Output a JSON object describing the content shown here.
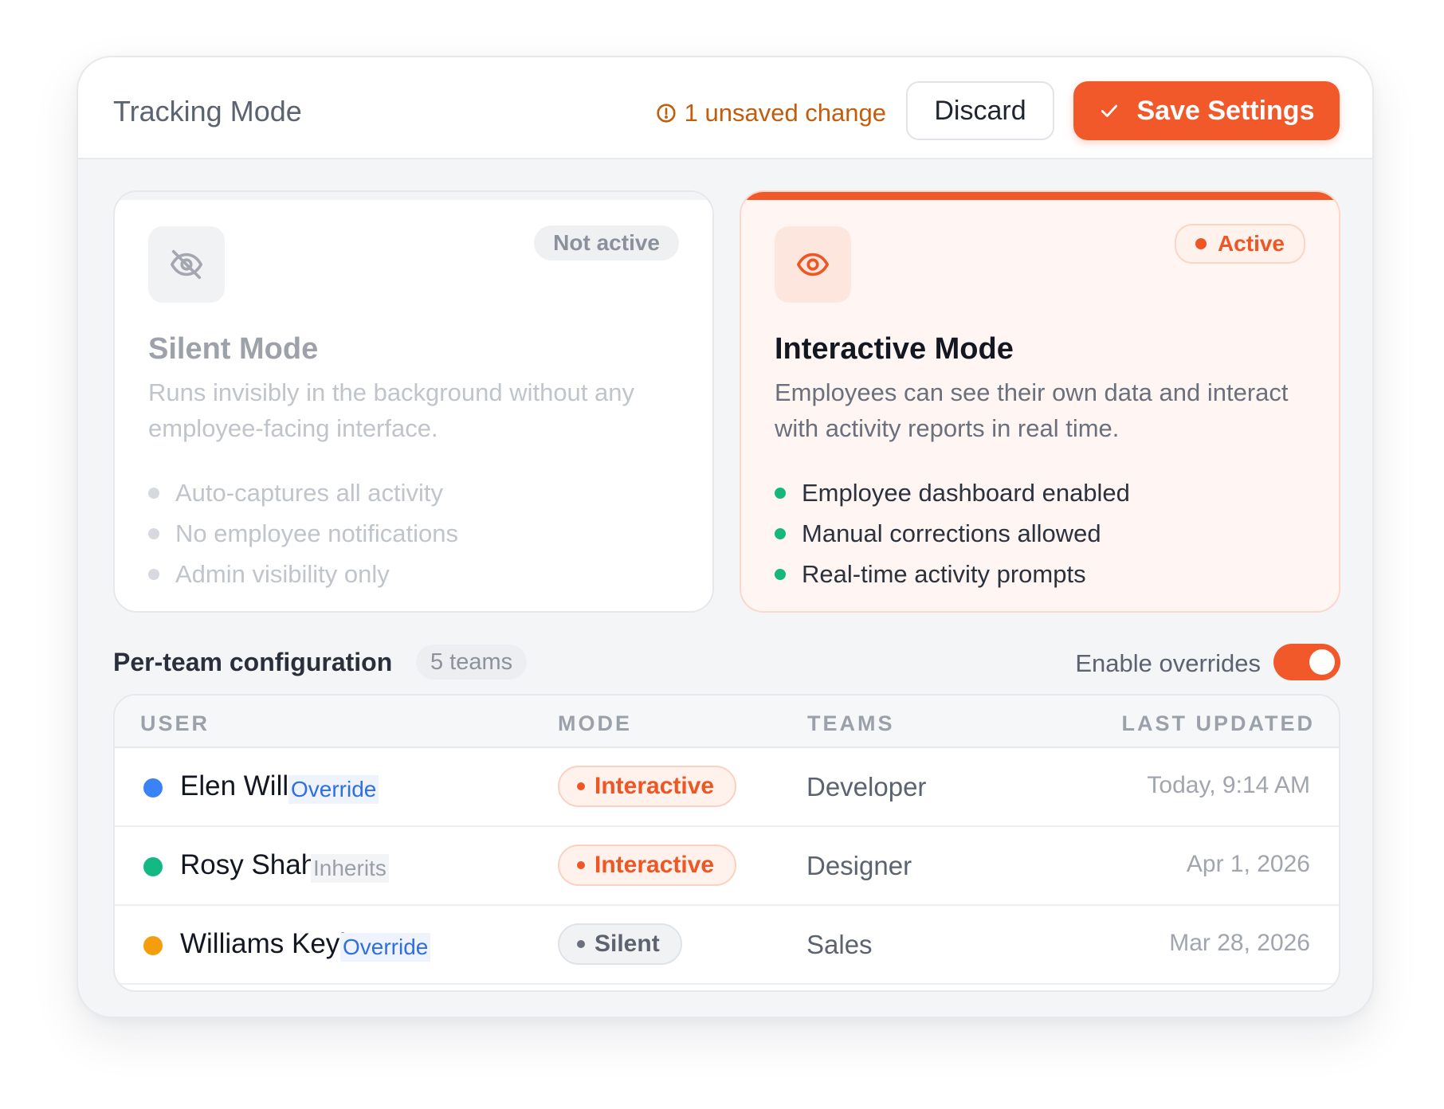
{
  "header": {
    "title": "Tracking Mode",
    "unsaved_text": "1 unsaved change",
    "discard_label": "Discard",
    "save_label": "Save Settings"
  },
  "modes": {
    "silent": {
      "title": "Silent Mode",
      "status": "Not active",
      "description": "Runs invisibly in the background without any employee-facing interface.",
      "features": [
        "Auto-captures all activity",
        "No employee notifications",
        "Admin visibility only"
      ],
      "icon": "eye-off-icon"
    },
    "interactive": {
      "title": "Interactive Mode",
      "status": "Active",
      "description": "Employees can see their own data and interact with activity reports in real time.",
      "features": [
        "Employee dashboard enabled",
        "Manual corrections allowed",
        "Real-time activity prompts"
      ],
      "icon": "eye-icon"
    }
  },
  "team_config": {
    "title": "Per-team configuration",
    "count_label": "5 teams",
    "overrides_label": "Enable overrides",
    "overrides_enabled": true
  },
  "table": {
    "columns": [
      "USER",
      "MODE",
      "TEAMS",
      "LAST UPDATED"
    ],
    "rows": [
      {
        "name": "Elen Will",
        "tag": "Override",
        "mode": "Interactive",
        "team": "Developer",
        "updated": "Today, 9:14 AM",
        "dot_color": "#3b82f6"
      },
      {
        "name": "Rosy Shah",
        "tag": "Inherits",
        "mode": "Interactive",
        "team": "Designer",
        "updated": "Apr 1, 2026",
        "dot_color": "#14b882"
      },
      {
        "name": "Williams Keyl",
        "tag": "Override",
        "mode": "Silent",
        "team": "Sales",
        "updated": "Mar 28, 2026",
        "dot_color": "#f59e0b"
      }
    ]
  },
  "colors": {
    "accent": "#f2592a",
    "warning_text": "#c25d0e",
    "success": "#16b77b",
    "override_blue": "#2f6fe0"
  }
}
